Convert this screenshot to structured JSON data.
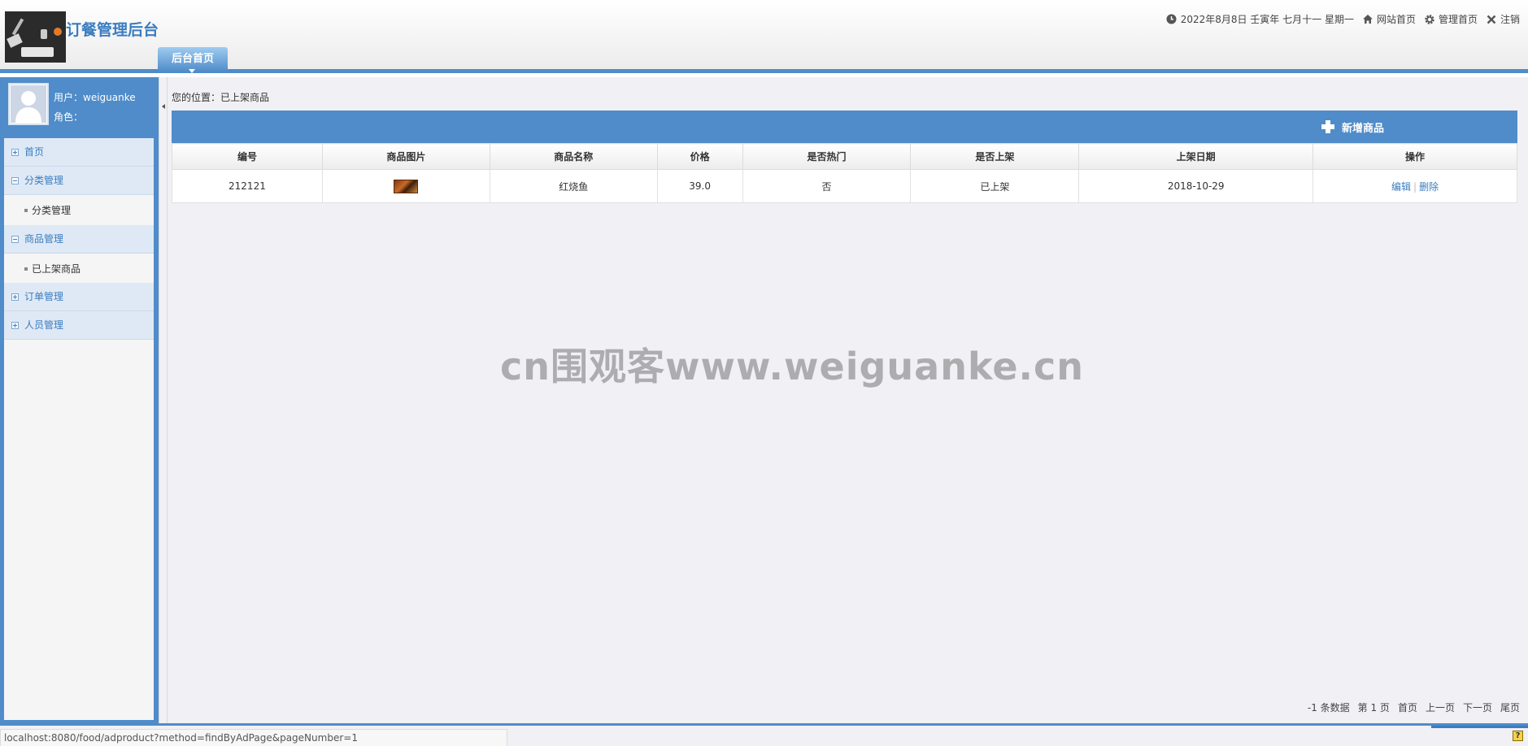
{
  "header": {
    "app_title": "订餐管理后台",
    "home_tab": "后台首页",
    "date_text": "2022年8月8日 壬寅年 七月十一 星期一",
    "links": {
      "site_home": "网站首页",
      "admin_home": "管理首页",
      "logout": "注销"
    },
    "icons": [
      "clock-icon",
      "home-icon",
      "gear-icon",
      "close-icon"
    ]
  },
  "sidebar": {
    "user_label": "用户：weiguanke",
    "role_label": "角色：",
    "menu": [
      {
        "label": "首页",
        "expanded": false
      },
      {
        "label": "分类管理",
        "expanded": true,
        "children": [
          "分类管理"
        ]
      },
      {
        "label": "商品管理",
        "expanded": true,
        "children": [
          "已上架商品"
        ]
      },
      {
        "label": "订单管理",
        "expanded": false
      },
      {
        "label": "人员管理",
        "expanded": false
      }
    ]
  },
  "main": {
    "breadcrumb": "您的位置：已上架商品",
    "add_button": "新增商品",
    "table": {
      "headers": [
        "编号",
        "商品图片",
        "商品名称",
        "价格",
        "是否热门",
        "是否上架",
        "上架日期",
        "操作"
      ],
      "rows": [
        {
          "id": "212121",
          "name": "红烧鱼",
          "price": "39.0",
          "hot": "否",
          "on_shelf": "已上架",
          "date": "2018-10-29",
          "edit": "编辑",
          "delete": "删除"
        }
      ]
    },
    "pager": {
      "count": "-1 条数据",
      "page": "第 1 页",
      "first": "首页",
      "prev": "上一页",
      "next": "下一页",
      "last": "尾页"
    }
  },
  "watermark": "cn围观客www.weiguanke.cn",
  "status_url": "localhost:8080/food/adproduct?method=findByAdPage&pageNumber=1",
  "colors": {
    "accent": "#4f8cc9",
    "link": "#3a7dc0",
    "background": "#f1f0f5"
  }
}
